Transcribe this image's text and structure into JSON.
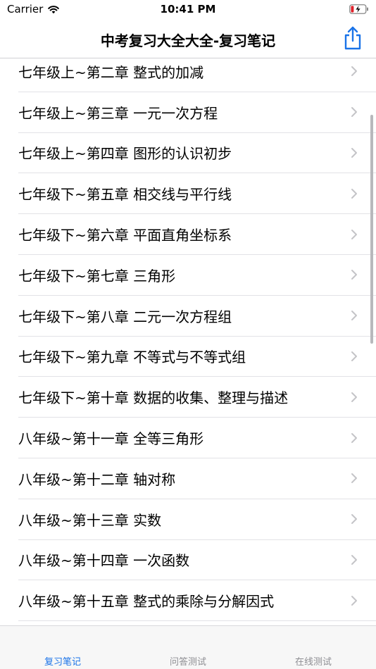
{
  "status_bar": {
    "carrier": "Carrier",
    "time": "10:41 PM"
  },
  "nav": {
    "title": "中考复习大全大全-复习笔记",
    "share_icon": "share-icon"
  },
  "list": {
    "items": [
      {
        "label": "七年级上~第二章  整式的加减"
      },
      {
        "label": "七年级上~第三章  一元一次方程"
      },
      {
        "label": "七年级上~第四章  图形的认识初步"
      },
      {
        "label": "七年级下~第五章  相交线与平行线"
      },
      {
        "label": "七年级下~第六章  平面直角坐标系"
      },
      {
        "label": "七年级下~第七章  三角形"
      },
      {
        "label": "七年级下~第八章  二元一次方程组"
      },
      {
        "label": "七年级下~第九章   不等式与不等式组"
      },
      {
        "label": "七年级下~第十章   数据的收集、整理与描述"
      },
      {
        "label": "八年级~第十一章   全等三角形"
      },
      {
        "label": "八年级~第十二章   轴对称"
      },
      {
        "label": "八年级~第十三章   实数"
      },
      {
        "label": "八年级~第十四章   一次函数"
      },
      {
        "label": "八年级~第十五章   整式的乘除与分解因式"
      }
    ]
  },
  "tabs": [
    {
      "label": "复习笔记",
      "active": true
    },
    {
      "label": "问答测试",
      "active": false
    },
    {
      "label": "在线测试",
      "active": false
    }
  ],
  "colors": {
    "accent": "#1a73e8",
    "share": "#1a73e8",
    "chevron": "#c4c4c7",
    "inactive_tab": "#8e8e93"
  }
}
